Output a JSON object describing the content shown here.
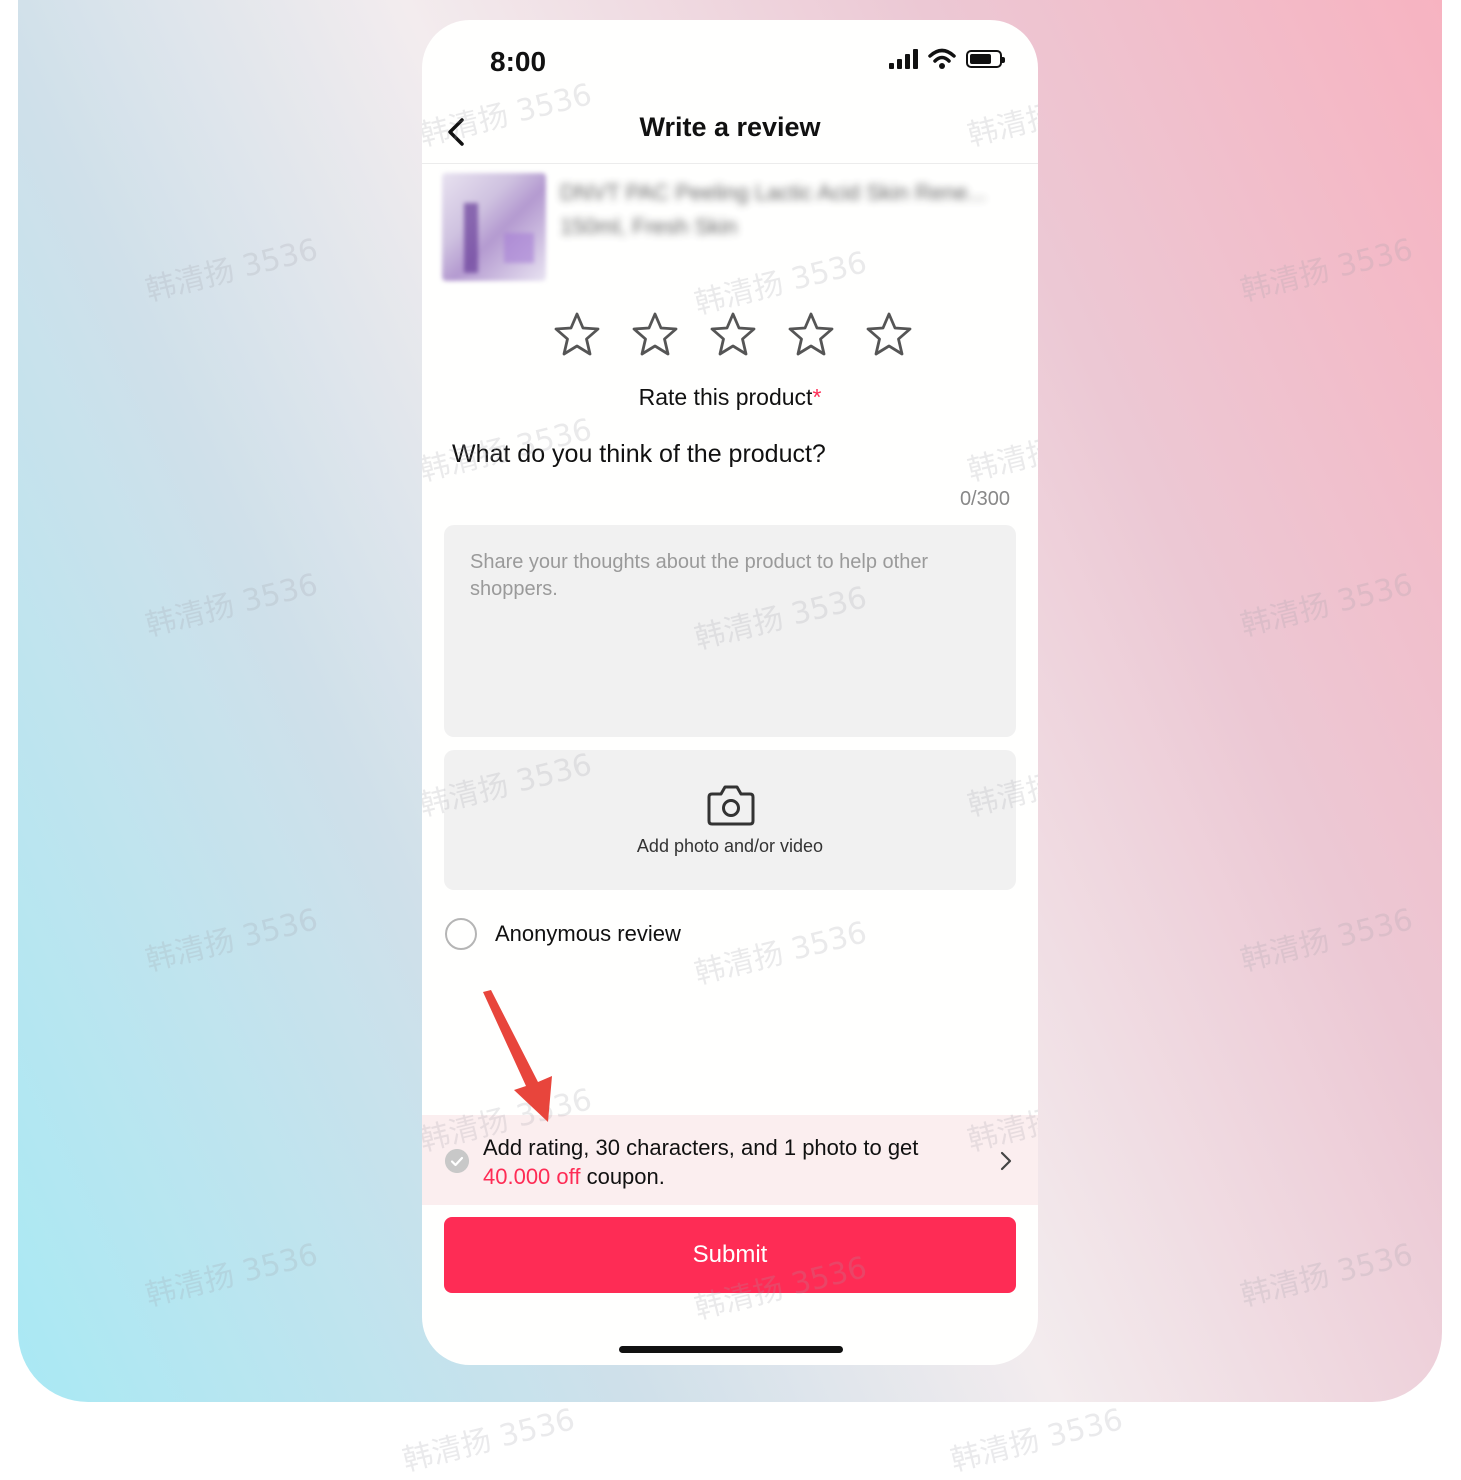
{
  "status_bar": {
    "time": "8:00"
  },
  "header": {
    "title": "Write a review"
  },
  "product": {
    "name": "DNVT PAC Peeling Lactic Acid Skin Rene... 150ml, Fresh Skin"
  },
  "rating": {
    "label": "Rate this product",
    "required_mark": "*",
    "stars": 5,
    "selected": 0
  },
  "review": {
    "question": "What do you think of the product?",
    "counter": "0/300",
    "placeholder": "Share your thoughts about the product to help other shoppers."
  },
  "media": {
    "label": "Add photo and/or video",
    "icon": "camera-icon"
  },
  "anonymous": {
    "label": "Anonymous review",
    "checked": false
  },
  "coupon": {
    "text_before": "Add rating, 30 characters, and 1 photo to get",
    "highlight": "40.000 off",
    "text_after": " coupon."
  },
  "submit": {
    "label": "Submit"
  },
  "watermark": "韩清扬 3536",
  "colors": {
    "accent": "#fe2c55",
    "coupon_bg": "#fbeeef",
    "input_bg": "#f1f1f1",
    "annotation_arrow": "#e8453c"
  }
}
